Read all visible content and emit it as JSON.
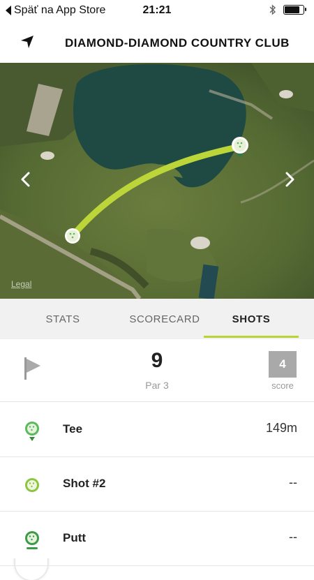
{
  "status_bar": {
    "back_app": "Späť na App Store",
    "time": "21:21",
    "battery_percent": 80
  },
  "header": {
    "title": "DIAMOND-DIAMOND COUNTRY CLUB",
    "back_icon": "back-arrow-icon"
  },
  "map": {
    "legal": "Legal",
    "prev_icon": "chevron-left-icon",
    "next_icon": "chevron-right-icon",
    "shot_line_color": "#bcd63a"
  },
  "tabs": [
    {
      "label": "STATS",
      "active": false
    },
    {
      "label": "SCORECARD",
      "active": false
    },
    {
      "label": "SHOTS",
      "active": true
    }
  ],
  "hole": {
    "number": "9",
    "par": "Par 3",
    "score": "4",
    "score_label": "score",
    "flag_icon": "flag-icon"
  },
  "shots": [
    {
      "name": "Tee",
      "distance": "149m",
      "icon": "golf-ball-tee-icon"
    },
    {
      "name": "Shot #2",
      "distance": "--",
      "icon": "golf-ball-icon"
    },
    {
      "name": "Putt",
      "distance": "--",
      "icon": "golf-ball-putt-icon"
    }
  ],
  "colors": {
    "accent": "#b8d334",
    "ball_green": "#5cb85c",
    "score_box": "#a9a9a9"
  }
}
